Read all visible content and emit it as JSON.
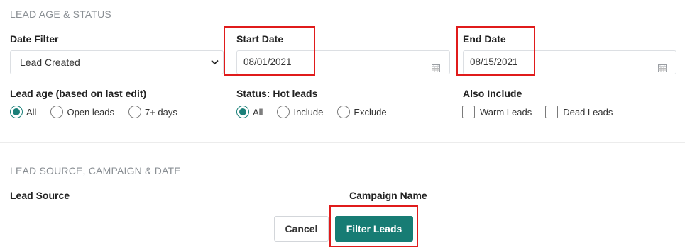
{
  "sections": {
    "lead_age_status": "LEAD AGE & STATUS",
    "lead_source": "LEAD SOURCE, CAMPAIGN & DATE"
  },
  "date_filter": {
    "label": "Date Filter",
    "value": "Lead Created"
  },
  "start_date": {
    "label": "Start Date",
    "value": "08/01/2021"
  },
  "end_date": {
    "label": "End Date",
    "value": "08/15/2021"
  },
  "lead_age": {
    "label": "Lead age (based on last edit)",
    "options": [
      "All",
      "Open leads",
      "7+ days"
    ],
    "selected": "All"
  },
  "hot_leads": {
    "label": "Status: Hot leads",
    "options": [
      "All",
      "Include",
      "Exclude"
    ],
    "selected": "All"
  },
  "also_include": {
    "label": "Also Include",
    "options": [
      "Warm Leads",
      "Dead Leads"
    ]
  },
  "lead_source_label": "Lead Source",
  "campaign_name_label": "Campaign Name",
  "buttons": {
    "cancel": "Cancel",
    "filter": "Filter Leads"
  },
  "colors": {
    "accent": "#177c74",
    "highlight": "#e01b1b"
  }
}
